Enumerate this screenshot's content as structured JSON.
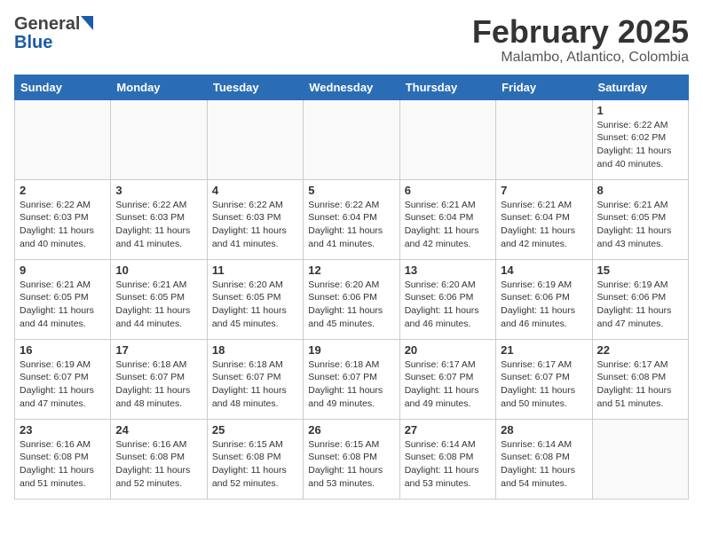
{
  "header": {
    "logo_general": "General",
    "logo_blue": "Blue",
    "month": "February 2025",
    "location": "Malambo, Atlantico, Colombia"
  },
  "days_of_week": [
    "Sunday",
    "Monday",
    "Tuesday",
    "Wednesday",
    "Thursday",
    "Friday",
    "Saturday"
  ],
  "weeks": [
    [
      {
        "day": "",
        "info": ""
      },
      {
        "day": "",
        "info": ""
      },
      {
        "day": "",
        "info": ""
      },
      {
        "day": "",
        "info": ""
      },
      {
        "day": "",
        "info": ""
      },
      {
        "day": "",
        "info": ""
      },
      {
        "day": "1",
        "info": "Sunrise: 6:22 AM\nSunset: 6:02 PM\nDaylight: 11 hours and 40 minutes."
      }
    ],
    [
      {
        "day": "2",
        "info": "Sunrise: 6:22 AM\nSunset: 6:03 PM\nDaylight: 11 hours and 40 minutes."
      },
      {
        "day": "3",
        "info": "Sunrise: 6:22 AM\nSunset: 6:03 PM\nDaylight: 11 hours and 41 minutes."
      },
      {
        "day": "4",
        "info": "Sunrise: 6:22 AM\nSunset: 6:03 PM\nDaylight: 11 hours and 41 minutes."
      },
      {
        "day": "5",
        "info": "Sunrise: 6:22 AM\nSunset: 6:04 PM\nDaylight: 11 hours and 41 minutes."
      },
      {
        "day": "6",
        "info": "Sunrise: 6:21 AM\nSunset: 6:04 PM\nDaylight: 11 hours and 42 minutes."
      },
      {
        "day": "7",
        "info": "Sunrise: 6:21 AM\nSunset: 6:04 PM\nDaylight: 11 hours and 42 minutes."
      },
      {
        "day": "8",
        "info": "Sunrise: 6:21 AM\nSunset: 6:05 PM\nDaylight: 11 hours and 43 minutes."
      }
    ],
    [
      {
        "day": "9",
        "info": "Sunrise: 6:21 AM\nSunset: 6:05 PM\nDaylight: 11 hours and 44 minutes."
      },
      {
        "day": "10",
        "info": "Sunrise: 6:21 AM\nSunset: 6:05 PM\nDaylight: 11 hours and 44 minutes."
      },
      {
        "day": "11",
        "info": "Sunrise: 6:20 AM\nSunset: 6:05 PM\nDaylight: 11 hours and 45 minutes."
      },
      {
        "day": "12",
        "info": "Sunrise: 6:20 AM\nSunset: 6:06 PM\nDaylight: 11 hours and 45 minutes."
      },
      {
        "day": "13",
        "info": "Sunrise: 6:20 AM\nSunset: 6:06 PM\nDaylight: 11 hours and 46 minutes."
      },
      {
        "day": "14",
        "info": "Sunrise: 6:19 AM\nSunset: 6:06 PM\nDaylight: 11 hours and 46 minutes."
      },
      {
        "day": "15",
        "info": "Sunrise: 6:19 AM\nSunset: 6:06 PM\nDaylight: 11 hours and 47 minutes."
      }
    ],
    [
      {
        "day": "16",
        "info": "Sunrise: 6:19 AM\nSunset: 6:07 PM\nDaylight: 11 hours and 47 minutes."
      },
      {
        "day": "17",
        "info": "Sunrise: 6:18 AM\nSunset: 6:07 PM\nDaylight: 11 hours and 48 minutes."
      },
      {
        "day": "18",
        "info": "Sunrise: 6:18 AM\nSunset: 6:07 PM\nDaylight: 11 hours and 48 minutes."
      },
      {
        "day": "19",
        "info": "Sunrise: 6:18 AM\nSunset: 6:07 PM\nDaylight: 11 hours and 49 minutes."
      },
      {
        "day": "20",
        "info": "Sunrise: 6:17 AM\nSunset: 6:07 PM\nDaylight: 11 hours and 49 minutes."
      },
      {
        "day": "21",
        "info": "Sunrise: 6:17 AM\nSunset: 6:07 PM\nDaylight: 11 hours and 50 minutes."
      },
      {
        "day": "22",
        "info": "Sunrise: 6:17 AM\nSunset: 6:08 PM\nDaylight: 11 hours and 51 minutes."
      }
    ],
    [
      {
        "day": "23",
        "info": "Sunrise: 6:16 AM\nSunset: 6:08 PM\nDaylight: 11 hours and 51 minutes."
      },
      {
        "day": "24",
        "info": "Sunrise: 6:16 AM\nSunset: 6:08 PM\nDaylight: 11 hours and 52 minutes."
      },
      {
        "day": "25",
        "info": "Sunrise: 6:15 AM\nSunset: 6:08 PM\nDaylight: 11 hours and 52 minutes."
      },
      {
        "day": "26",
        "info": "Sunrise: 6:15 AM\nSunset: 6:08 PM\nDaylight: 11 hours and 53 minutes."
      },
      {
        "day": "27",
        "info": "Sunrise: 6:14 AM\nSunset: 6:08 PM\nDaylight: 11 hours and 53 minutes."
      },
      {
        "day": "28",
        "info": "Sunrise: 6:14 AM\nSunset: 6:08 PM\nDaylight: 11 hours and 54 minutes."
      },
      {
        "day": "",
        "info": ""
      }
    ]
  ]
}
